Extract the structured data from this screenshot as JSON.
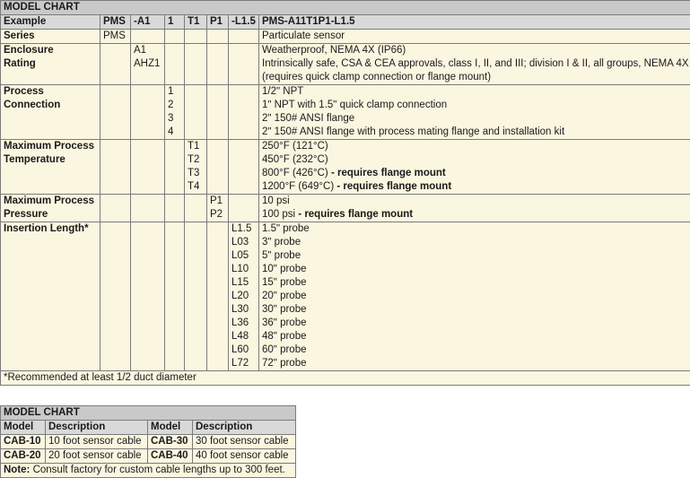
{
  "main_chart": {
    "title": "MODEL CHART",
    "example": {
      "label": "Example",
      "series": "PMS",
      "enclosure": "-A1",
      "connection": "1",
      "temperature": "T1",
      "pressure": "P1",
      "length": "-L1.5",
      "full": "PMS-A11T1P1-L1.5"
    },
    "series_row": {
      "label": "Series",
      "code": "PMS",
      "desc": "Particulate sensor"
    },
    "enclosure": {
      "label_line1": "Enclosure",
      "label_line2": "Rating",
      "codes": [
        "A1",
        "AHZ1"
      ],
      "descs": [
        "Weatherproof, NEMA 4X (IP66)",
        "Intrinsically safe, CSA & CEA approvals, class I, II, and III; division I & II, all groups, NEMA 4X",
        "(requires quick clamp connection or flange mount)"
      ]
    },
    "connection": {
      "label_line1": "Process",
      "label_line2": "Connection",
      "codes": [
        "1",
        "2",
        "3",
        "4"
      ],
      "descs": [
        "1/2ʺ NPT",
        "1ʺ NPT with 1.5ʺ quick clamp connection",
        "2ʺ 150# ANSI flange",
        "2ʺ 150# ANSI flange with process mating flange and installation kit"
      ]
    },
    "temperature": {
      "label_line1": "Maximum Process",
      "label_line2": "Temperature",
      "codes": [
        "T1",
        "T2",
        "T3",
        "T4"
      ],
      "descs": [
        {
          "main": "250°F (121°C)",
          "extra": ""
        },
        {
          "main": "450°F (232°C)",
          "extra": ""
        },
        {
          "main": "800°F (426°C)",
          "extra": " - requires flange mount"
        },
        {
          "main": "1200°F (649°C)",
          "extra": " - requires flange mount"
        }
      ]
    },
    "pressure": {
      "label_line1": "Maximum Process",
      "label_line2": "Pressure",
      "codes": [
        "P1",
        "P2"
      ],
      "descs": [
        {
          "main": "10 psi",
          "extra": ""
        },
        {
          "main": "100 psi",
          "extra": " - requires flange mount"
        }
      ]
    },
    "insertion": {
      "label": "Insertion Length*",
      "codes": [
        "L1.5",
        "L03",
        "L05",
        "L10",
        "L15",
        "L20",
        "L30",
        "L36",
        "L48",
        "L60",
        "L72"
      ],
      "descs": [
        "1.5ʺ probe",
        "3ʺ probe",
        "5ʺ probe",
        "10ʺ probe",
        "15ʺ probe",
        "20ʺ probe",
        "30ʺ probe",
        "36ʺ probe",
        "48ʺ probe",
        "60ʺ probe",
        "72ʺ probe"
      ]
    },
    "footnote": "*Recommended at least 1/2 duct diameter"
  },
  "cable_chart": {
    "title": "MODEL CHART",
    "headers": [
      "Model",
      "Description",
      "Model",
      "Description"
    ],
    "rows": [
      [
        "CAB-10",
        "10 foot sensor cable",
        "CAB-30",
        "30 foot sensor cable"
      ],
      [
        "CAB-20",
        "20 foot sensor cable",
        "CAB-40",
        "40 foot sensor cable"
      ]
    ],
    "note_label": "Note:",
    "note_text": " Consult factory for custom cable lengths up to 300 feet."
  }
}
